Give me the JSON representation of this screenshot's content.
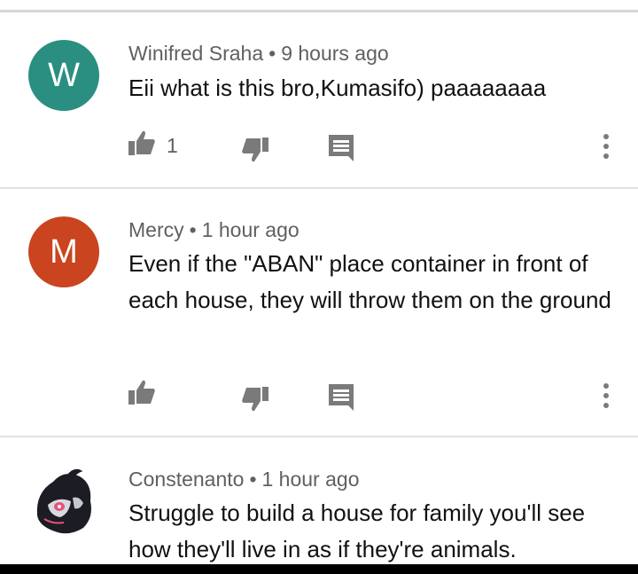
{
  "comments": [
    {
      "author": "Winifred Sraha",
      "time": "9 hours ago",
      "text": "Eii what is this bro,Kumasifo) paaaaaaaa",
      "avatar_letter": "W",
      "avatar_color": "#2a8f80",
      "likes": "1"
    },
    {
      "author": "Mercy",
      "time": "1 hour ago",
      "text": "Even if the  \"ABAN\" place container in front of each house, they will throw them on the ground",
      "avatar_letter": "M",
      "avatar_color": "#c9441f",
      "likes": ""
    },
    {
      "author": "Constenanto",
      "time": "1 hour ago",
      "text": "Struggle to build a house for family you'll see how they'll live in as if they're animals.",
      "avatar_letter": "",
      "avatar_color": "#222222",
      "likes": ""
    }
  ],
  "separator": "•",
  "icons": {
    "like": "thumb-up-icon",
    "dislike": "thumb-down-icon",
    "reply": "comment-icon",
    "more": "more-vert-icon"
  }
}
